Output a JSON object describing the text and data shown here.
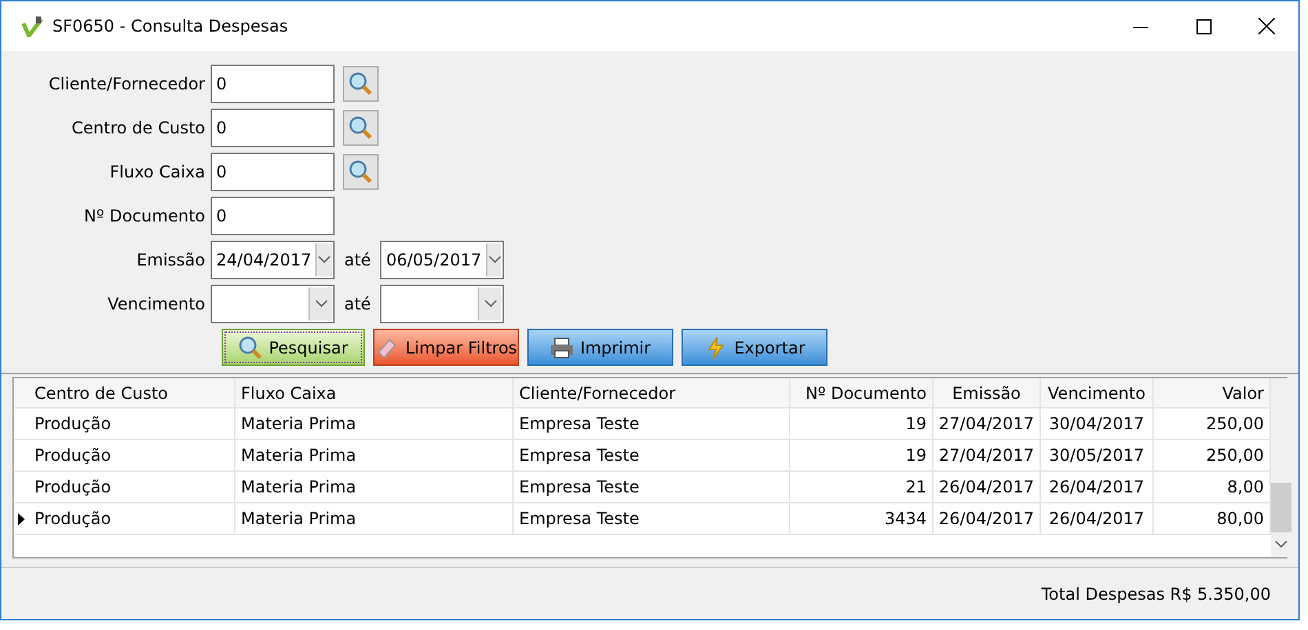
{
  "window": {
    "title": "SF0650 - Consulta Despesas"
  },
  "filters": [
    {
      "kind": "lookup",
      "label": "Cliente/Fornecedor",
      "value": "0"
    },
    {
      "kind": "lookup",
      "label": "Centro de Custo",
      "value": "0"
    },
    {
      "kind": "lookup",
      "label": "Fluxo Caixa",
      "value": "0"
    },
    {
      "kind": "text",
      "label": "Nº Documento",
      "value": "0"
    },
    {
      "kind": "range",
      "label": "Emissão",
      "from": "24/04/2017",
      "to_label": "até",
      "to": "06/05/2017"
    },
    {
      "kind": "range",
      "label": "Vencimento",
      "to_label": "até"
    }
  ],
  "buttons": [
    {
      "kind": "search",
      "label": "Pesquisar",
      "focused": true
    },
    {
      "kind": "clear",
      "label": "Limpar Filtros",
      "focused": false
    },
    {
      "kind": "print",
      "label": "Imprimir",
      "focused": false
    },
    {
      "kind": "export",
      "label": "Exportar",
      "focused": false
    }
  ],
  "table": {
    "columns": [
      {
        "label": "Centro de Custo"
      },
      {
        "label": "Fluxo Caixa"
      },
      {
        "label": "Cliente/Fornecedor"
      },
      {
        "label": "Nº Documento"
      },
      {
        "label": "Emissão"
      },
      {
        "label": "Vencimento"
      },
      {
        "label": "Valor"
      }
    ],
    "rows": [
      {
        "selected": false,
        "cells": [
          "Produção",
          "Materia Prima",
          "Empresa Teste",
          "19",
          "27/04/2017",
          "30/04/2017",
          "250,00"
        ]
      },
      {
        "selected": false,
        "cells": [
          "Produção",
          "Materia Prima",
          "Empresa Teste",
          "19",
          "27/04/2017",
          "30/05/2017",
          "250,00"
        ]
      },
      {
        "selected": false,
        "cells": [
          "Produção",
          "Materia Prima",
          "Empresa Teste",
          "21",
          "26/04/2017",
          "26/04/2017",
          "8,00"
        ]
      },
      {
        "selected": true,
        "cells": [
          "Produção",
          "Materia Prima",
          "Empresa Teste",
          "3434",
          "26/04/2017",
          "26/04/2017",
          "80,00"
        ]
      }
    ]
  },
  "status_bar": {
    "total": "Total Despesas R$ 5.350,00"
  }
}
